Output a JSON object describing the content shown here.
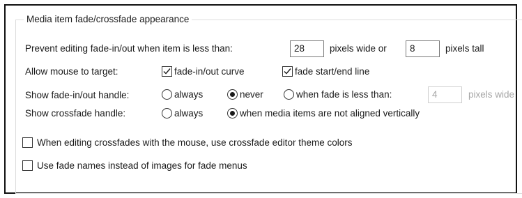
{
  "group": {
    "title": "Media item fade/crossfade appearance"
  },
  "prevent_editing": {
    "label": "Prevent editing fade-in/out when item is less than:",
    "width_value": "28",
    "width_suffix": "pixels wide or",
    "height_value": "8",
    "height_suffix": "pixels tall"
  },
  "mouse_target": {
    "label": "Allow mouse to target:",
    "fade_curve": {
      "label": "fade-in/out curve",
      "checked": true
    },
    "fade_line": {
      "label": "fade start/end line",
      "checked": true
    }
  },
  "fade_handle": {
    "label": "Show fade-in/out handle:",
    "options": [
      {
        "label": "always",
        "selected": false
      },
      {
        "label": "never",
        "selected": true
      },
      {
        "label": "when fade is less than:",
        "selected": false
      }
    ],
    "threshold_value": "4",
    "threshold_suffix": "pixels wide"
  },
  "crossfade_handle": {
    "label": "Show crossfade handle:",
    "options": [
      {
        "label": "always",
        "selected": false
      },
      {
        "label": "when media items are not aligned vertically",
        "selected": true
      }
    ]
  },
  "options": {
    "crossfade_theme": {
      "label": "When editing crossfades with the mouse, use crossfade editor theme colors",
      "checked": false
    },
    "fade_names": {
      "label": "Use fade names instead of images for fade menus",
      "checked": false
    }
  }
}
